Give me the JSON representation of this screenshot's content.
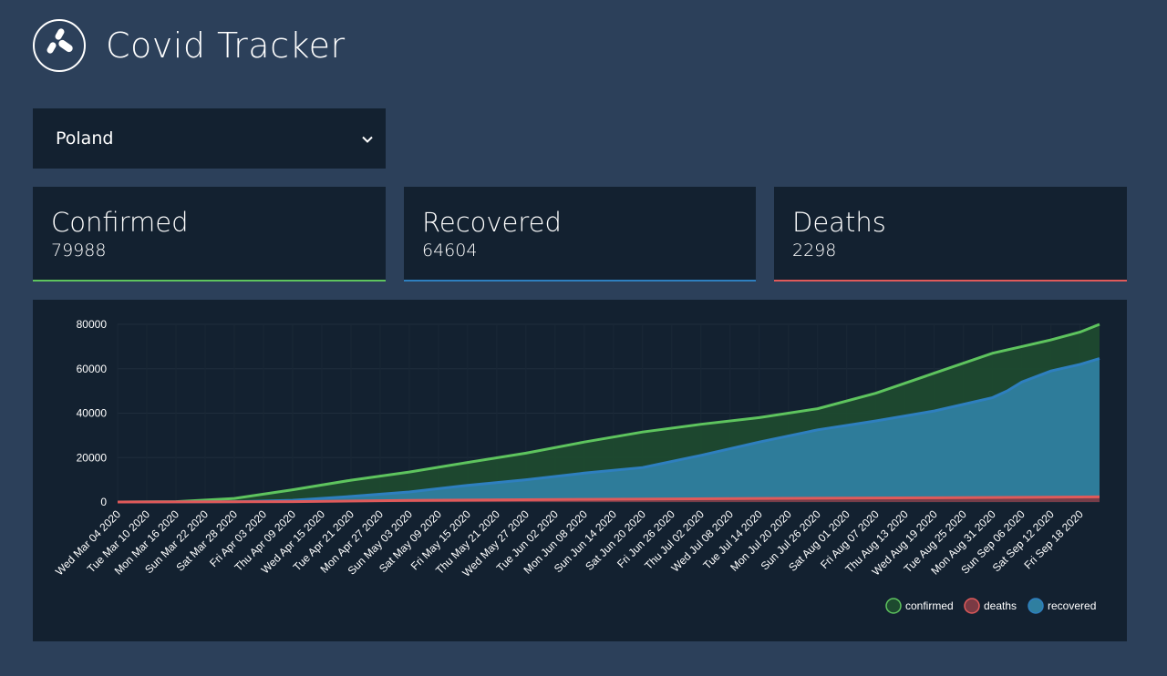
{
  "app": {
    "title": "Covid Tracker",
    "logo_icon": "covid-logo-icon"
  },
  "country_select": {
    "selected": "Poland"
  },
  "stats": {
    "confirmed": {
      "label": "Confirmed",
      "value": "79988",
      "color": "#5ec45e"
    },
    "recovered": {
      "label": "Recovered",
      "value": "64604",
      "color": "#2e7fbf"
    },
    "deaths": {
      "label": "Deaths",
      "value": "2298",
      "color": "#e05a5a"
    }
  },
  "chart_data": {
    "type": "area",
    "x_start": "2020-03-04",
    "x_end": "2020-09-22",
    "tick_labels": [
      "Wed Mar 04 2020",
      "Tue Mar 10 2020",
      "Mon Mar 16 2020",
      "Sun Mar 22 2020",
      "Sat Mar 28 2020",
      "Fri Apr 03 2020",
      "Thu Apr 09 2020",
      "Wed Apr 15 2020",
      "Tue Apr 21 2020",
      "Mon Apr 27 2020",
      "Sun May 03 2020",
      "Sat May 09 2020",
      "Fri May 15 2020",
      "Thu May 21 2020",
      "Wed May 27 2020",
      "Tue Jun 02 2020",
      "Mon Jun 08 2020",
      "Sun Jun 14 2020",
      "Sat Jun 20 2020",
      "Fri Jun 26 2020",
      "Thu Jul 02 2020",
      "Wed Jul 08 2020",
      "Tue Jul 14 2020",
      "Mon Jul 20 2020",
      "Sun Jul 26 2020",
      "Sat Aug 01 2020",
      "Fri Aug 07 2020",
      "Thu Aug 13 2020",
      "Wed Aug 19 2020",
      "Tue Aug 25 2020",
      "Mon Aug 31 2020",
      "Sun Sep 06 2020",
      "Sat Sep 12 2020",
      "Fri Sep 18 2020"
    ],
    "y_ticks": [
      "80000",
      "60000",
      "40000",
      "20000",
      "0"
    ],
    "ylim": [
      0,
      80000
    ],
    "grid": true,
    "legend_position": "bottom-right",
    "series": [
      {
        "name": "confirmed",
        "color": "#5ec45e",
        "fill": "#1d4a2f",
        "points": [
          [
            "2020-03-04",
            0
          ],
          [
            "2020-03-16",
            150
          ],
          [
            "2020-03-28",
            1600
          ],
          [
            "2020-04-09",
            5500
          ],
          [
            "2020-04-21",
            9800
          ],
          [
            "2020-05-03",
            13500
          ],
          [
            "2020-05-15",
            17800
          ],
          [
            "2020-05-27",
            22000
          ],
          [
            "2020-06-08",
            27000
          ],
          [
            "2020-06-20",
            31500
          ],
          [
            "2020-07-02",
            35000
          ],
          [
            "2020-07-14",
            38000
          ],
          [
            "2020-07-26",
            42000
          ],
          [
            "2020-08-07",
            49000
          ],
          [
            "2020-08-19",
            58000
          ],
          [
            "2020-08-31",
            67000
          ],
          [
            "2020-09-06",
            70000
          ],
          [
            "2020-09-12",
            73000
          ],
          [
            "2020-09-18",
            76500
          ],
          [
            "2020-09-22",
            79988
          ]
        ]
      },
      {
        "name": "recovered",
        "color": "#2e7fbf",
        "fill": "#2f7fa0",
        "points": [
          [
            "2020-03-04",
            0
          ],
          [
            "2020-03-28",
            100
          ],
          [
            "2020-04-09",
            800
          ],
          [
            "2020-04-21",
            2500
          ],
          [
            "2020-05-03",
            4500
          ],
          [
            "2020-05-15",
            7500
          ],
          [
            "2020-05-27",
            10000
          ],
          [
            "2020-06-08",
            13000
          ],
          [
            "2020-06-20",
            15500
          ],
          [
            "2020-07-02",
            21000
          ],
          [
            "2020-07-14",
            27000
          ],
          [
            "2020-07-26",
            32500
          ],
          [
            "2020-08-07",
            36500
          ],
          [
            "2020-08-19",
            41000
          ],
          [
            "2020-08-31",
            47000
          ],
          [
            "2020-09-03",
            50000
          ],
          [
            "2020-09-06",
            54000
          ],
          [
            "2020-09-12",
            59000
          ],
          [
            "2020-09-18",
            62000
          ],
          [
            "2020-09-22",
            64604
          ]
        ]
      },
      {
        "name": "deaths",
        "color": "#e05a5a",
        "fill": "#7a3a44",
        "points": [
          [
            "2020-03-04",
            0
          ],
          [
            "2020-04-09",
            150
          ],
          [
            "2020-05-03",
            700
          ],
          [
            "2020-06-08",
            1200
          ],
          [
            "2020-07-14",
            1600
          ],
          [
            "2020-08-19",
            1900
          ],
          [
            "2020-09-22",
            2298
          ]
        ]
      }
    ]
  }
}
